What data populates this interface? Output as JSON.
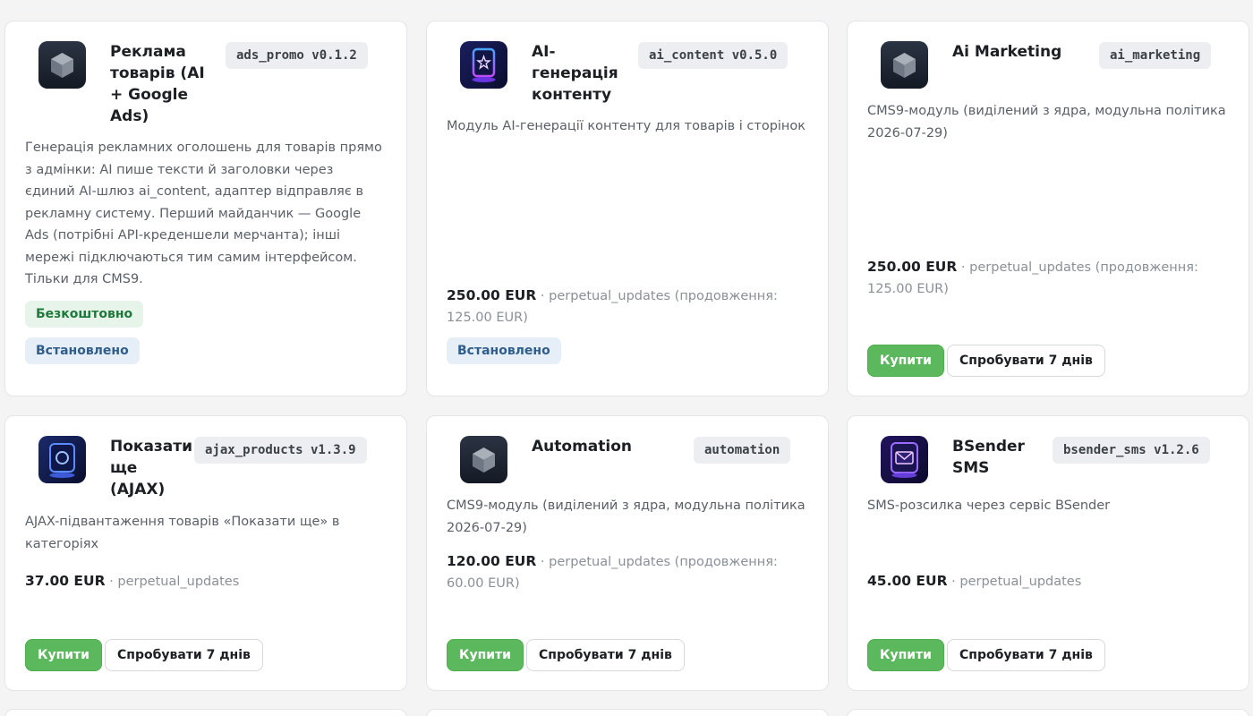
{
  "cards": [
    {
      "title_lines": [
        "Реклама",
        "товарів (AI",
        "+ Google",
        "Ads)"
      ],
      "slug": "ads_promo v0.1.2",
      "icon": "cube-icon",
      "description_lines": [
        "Генерація рекламних оголошень для товарів прямо",
        "з адмінки: AI пише тексти й заголовки через",
        "єдиний AI-шлюз ai_content, адаптер відправляє в",
        "рекламну систему. Перший майданчик — Google",
        "Ads (потрібні API-креденшели мерчанта); інші",
        "мережі підключаються тим самим інтерфейсом.",
        "Тільки для CMS9."
      ],
      "badges": [
        "Безкоштовно",
        "Встановлено"
      ]
    },
    {
      "title_lines": [
        "AI-",
        "генерація",
        "контенту"
      ],
      "slug": "ai_content v0.5.0",
      "icon": "ai-portal-icon",
      "description_lines": [
        "Модуль AI-генерації контенту для товарів і сторінок"
      ],
      "price": "250.00 EUR",
      "price_note_lines": [
        " · perpetual_updates (продовження:",
        "125.00 EUR)"
      ],
      "badges": [
        "Встановлено"
      ]
    },
    {
      "title_lines": [
        "Ai Marketing"
      ],
      "slug": "ai_marketing",
      "icon": "cube-icon",
      "description_lines": [
        "CMS9-модуль (виділений з ядра, модульна політика",
        "2026-07-29)"
      ],
      "price": "250.00 EUR",
      "price_note_lines": [
        " · perpetual_updates (продовження:",
        "125.00 EUR)"
      ],
      "buy_label": "Купити",
      "try_label": "Спробувати 7 днів"
    },
    {
      "title_lines": [
        "Показати",
        "ще",
        "(AJAX)"
      ],
      "slug": "ajax_products v1.3.9",
      "icon": "ajax-circle-icon",
      "description_lines": [
        "AJAX-підвантаження товарів «Показати ще» в",
        "категоріях"
      ],
      "price": "37.00 EUR",
      "price_note_lines": [
        " · perpetual_updates"
      ],
      "buy_label": "Купити",
      "try_label": "Спробувати 7 днів"
    },
    {
      "title_lines": [
        "Automation"
      ],
      "slug": "automation",
      "icon": "cube-icon",
      "description_lines": [
        "CMS9-модуль (виділений з ядра, модульна політика",
        "2026-07-29)"
      ],
      "price": "120.00 EUR",
      "price_note_lines": [
        " · perpetual_updates (продовження:",
        "60.00 EUR)"
      ],
      "buy_label": "Купити",
      "try_label": "Спробувати 7 днів"
    },
    {
      "title_lines": [
        "BSender",
        "SMS"
      ],
      "slug": "bsender_sms v1.2.6",
      "icon": "envelope-icon",
      "description_lines": [
        "SMS-розсилка через сервіс BSender"
      ],
      "price": "45.00 EUR",
      "price_note_lines": [
        " · perpetual_updates"
      ],
      "buy_label": "Купити",
      "try_label": "Спробувати 7 днів"
    }
  ],
  "colors": {
    "buy_button": "#5cb85c",
    "free_badge_bg": "#e6f4ea",
    "installed_badge_bg": "#e6eef8",
    "slug_bg": "#eceef1"
  }
}
